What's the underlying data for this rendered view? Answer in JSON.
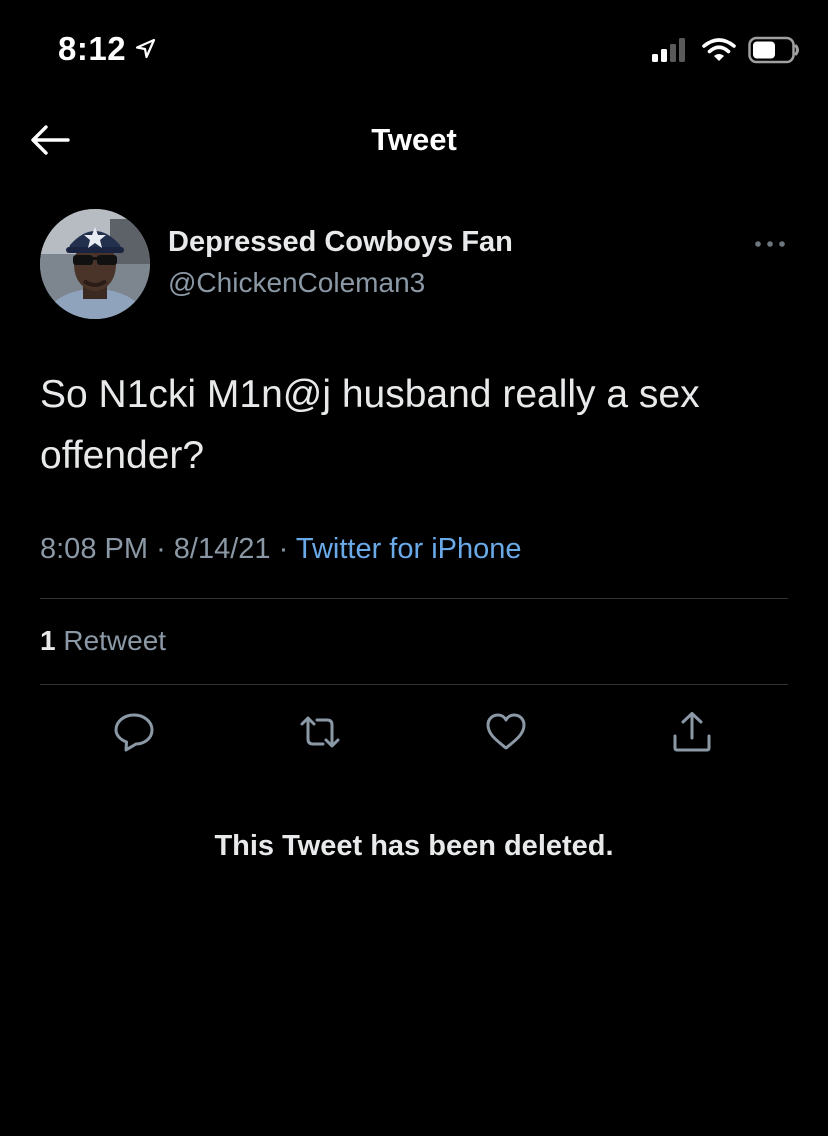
{
  "status_bar": {
    "time": "8:12",
    "location_icon": "location-arrow-icon",
    "signal_icon": "cellular-signal-icon",
    "wifi_icon": "wifi-icon",
    "battery_icon": "battery-icon"
  },
  "header": {
    "title": "Tweet",
    "back_icon": "arrow-left-icon"
  },
  "tweet": {
    "author": {
      "display_name": "Depressed Cowboys Fan",
      "handle": "@ChickenColeman3"
    },
    "text": "So N1cki M1n@j husband really a sex offender?",
    "time": "8:08 PM",
    "separator": "·",
    "date": "8/14/21",
    "source": "Twitter for iPhone",
    "retweet_count": "1",
    "retweet_label": "Retweet"
  },
  "actions": {
    "reply_icon": "reply-icon",
    "retweet_icon": "retweet-icon",
    "like_icon": "heart-icon",
    "share_icon": "share-icon"
  },
  "notice": {
    "deleted_text": "This Tweet has been deleted."
  },
  "colors": {
    "background": "#000000",
    "primary_text": "#e7e9ea",
    "secondary_text": "#8b98a5",
    "link": "#6aa9e8",
    "divider": "#2f3336"
  }
}
